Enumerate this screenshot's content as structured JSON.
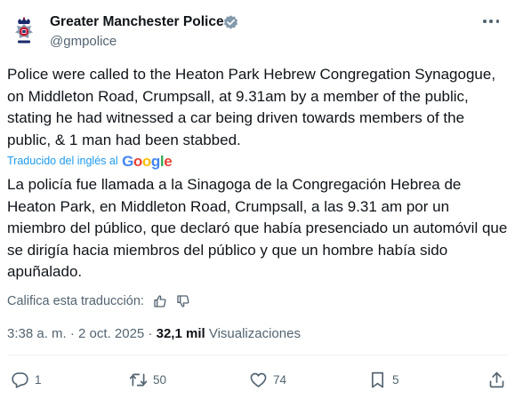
{
  "author": {
    "name": "Greater Manchester Police",
    "handle": "@gmpolice"
  },
  "tweet": {
    "text": "Police were called to the Heaton Park Hebrew Congregation Synagogue, on Middleton Road, Crumpsall, at 9.31am by a member of the public, stating he had witnessed a car being driven towards members of the public, & 1 man had been stabbed.",
    "translated_by": "Traducido del inglés al",
    "translator_logo": "Google",
    "translation": "La policía fue llamada a la Sinagoga de la Congregación Hebrea de Heaton Park, en Middleton Road, Crumpsall, a las 9.31 am por un miembro del público, que declaró que había presenciado un automóvil que se dirigía hacia miembros del público y que un hombre había sido apuñalado.",
    "rate_translation": "Califica esta traducción:",
    "time": "3:38 a. m.",
    "separator": "·",
    "date": "2 oct. 2025",
    "views_count": "32,1 mil",
    "views_label": "Visualizaciones"
  },
  "actions": {
    "replies": "1",
    "reposts": "50",
    "likes": "74",
    "bookmarks": "5"
  },
  "colors": {
    "text": "#0f1419",
    "secondary": "#536471",
    "link": "#1d9bf0",
    "verified_badge": "#829aab",
    "divider": "#eff3f4"
  },
  "icons": {
    "avatar": "police-crest-icon",
    "verified": "verified-badge-icon",
    "more": "more-icon",
    "thumbs_up": "thumbs-up-icon",
    "thumbs_down": "thumbs-down-icon",
    "reply": "reply-icon",
    "repost": "repost-icon",
    "like": "heart-icon",
    "bookmark": "bookmark-icon",
    "share": "share-icon"
  }
}
